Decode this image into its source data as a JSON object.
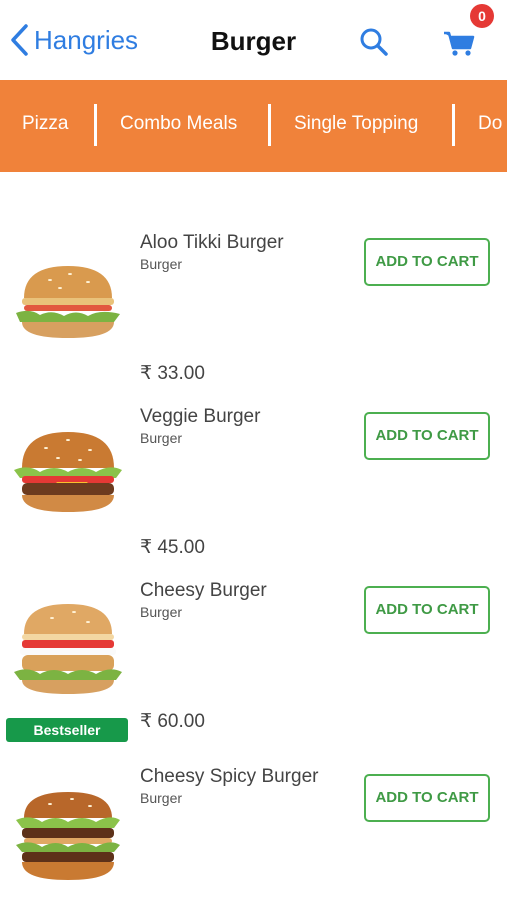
{
  "nav": {
    "back_label": "Hangries",
    "title": "Burger",
    "cart_count": "0"
  },
  "categories": [
    "Pizza",
    "Combo Meals",
    "Single Topping",
    "Do"
  ],
  "products": [
    {
      "name": "Aloo Tikki Burger",
      "category": "Burger",
      "price": "₹ 33.00",
      "button": "ADD TO CART",
      "badge": ""
    },
    {
      "name": "Veggie Burger",
      "category": "Burger",
      "price": "₹ 45.00",
      "button": "ADD TO CART",
      "badge": ""
    },
    {
      "name": "Cheesy Burger",
      "category": "Burger",
      "price": "₹ 60.00",
      "button": "ADD TO CART",
      "badge": "Bestseller"
    },
    {
      "name": "Cheesy Spicy Burger",
      "category": "Burger",
      "price": "",
      "button": "ADD TO CART",
      "badge": ""
    }
  ],
  "colors": {
    "accent": "#2f7de1",
    "category_bar": "#f0823a",
    "button_border": "#4caf50",
    "badge": "#17994a",
    "cart_badge": "#e53935"
  }
}
